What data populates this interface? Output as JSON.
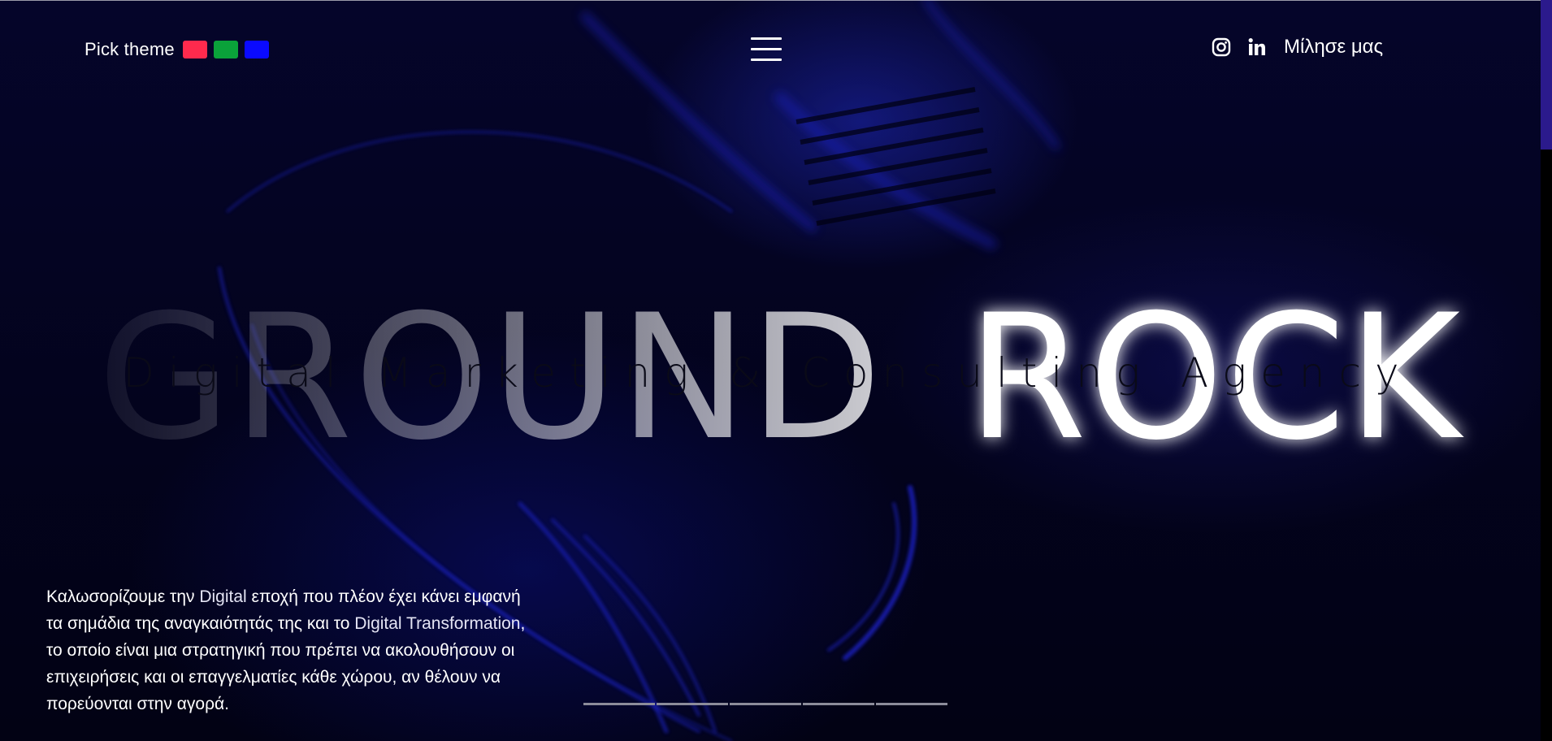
{
  "header": {
    "theme_label": "Pick theme",
    "theme_swatches": [
      {
        "name": "red",
        "color": "#ff2a4d"
      },
      {
        "name": "green",
        "color": "#0aa23a"
      },
      {
        "name": "blue",
        "color": "#0a0aff"
      }
    ],
    "menu_icon": "hamburger-icon",
    "social_icons": [
      "instagram-icon",
      "linkedin-icon"
    ],
    "contact_label": "Μίλησε μας"
  },
  "hero": {
    "title_words": [
      "GROUND",
      "ROCK"
    ],
    "subtitle": "Digital Marketing & Consulting Agency"
  },
  "intro": {
    "part1": "Καλωσορίζουμε την ",
    "part2": "Digital",
    "part3": " εποχή που πλέον έχει κάνει εμφανή τα σημάδια της αναγκαιότητάς της και το ",
    "part4": "Digital Transformation",
    "part5": ", το οποίο είναι μια στρατηγική που πρέπει να ακολουθήσουν οι επιχειρήσεις και οι επαγγελματίες κάθε χώρου, αν θέλουν να πορεύονται στην αγορά."
  },
  "slider": {
    "dot_count": 5
  },
  "colors": {
    "background": "#04041f",
    "accent_blue": "#1a28d6",
    "scroll_thumb": "#2b1a8c"
  }
}
